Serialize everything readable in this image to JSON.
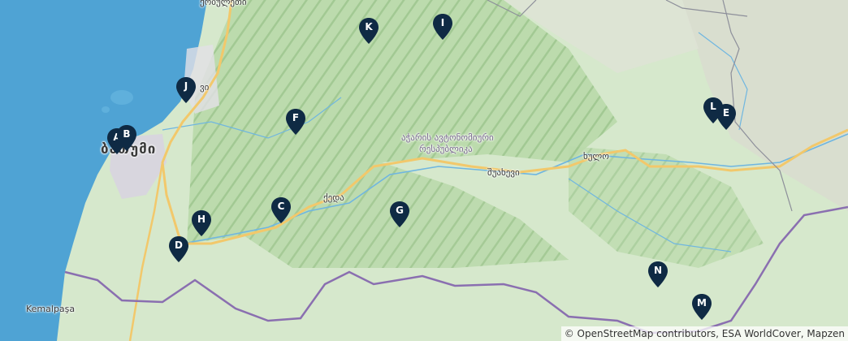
{
  "map": {
    "places": {
      "kobuleti": "ქობულეთი",
      "batumi": "ბათუმი",
      "keda": "ქედა",
      "shuakhevi": "შუახევი",
      "khulo": "ხულო",
      "adjara_line1": "აჭარის ავტონომიური",
      "adjara_line2": "რესპუბლიკა",
      "kemalpasa": "Kemalpaşa",
      "partial_label": "ვი"
    },
    "markers": [
      "A",
      "B",
      "C",
      "D",
      "E",
      "F",
      "G",
      "H",
      "I",
      "J",
      "K",
      "L",
      "M",
      "N"
    ],
    "colors": {
      "water": "#4fa3d4",
      "land": "#cfe3c4",
      "forest": "#a9cf9c",
      "road": "#f2c86b",
      "border": "#8a6fb0",
      "marker": "#0f2a44"
    }
  },
  "attribution": "© OpenStreetMap contributors, ESA WorldCover, Mapzen"
}
